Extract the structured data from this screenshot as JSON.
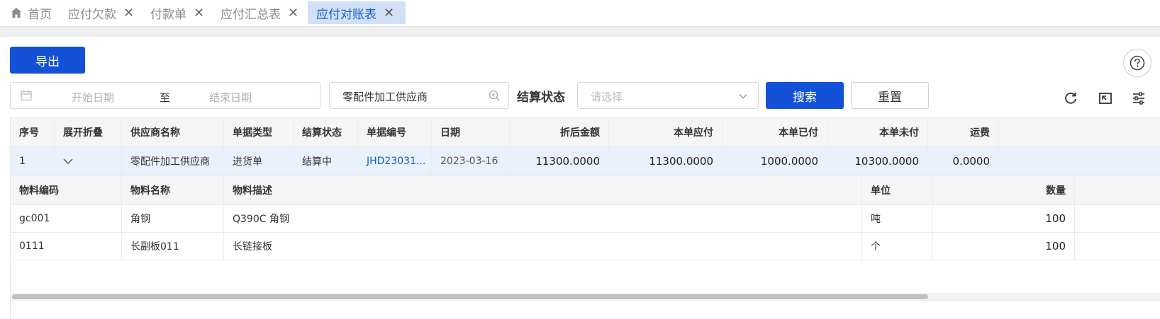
{
  "tabs": [
    {
      "label": "首页",
      "closable": false,
      "active": false
    },
    {
      "label": "应付欠款",
      "closable": true,
      "active": false
    },
    {
      "label": "付款单",
      "closable": true,
      "active": false
    },
    {
      "label": "应付汇总表",
      "closable": true,
      "active": false
    },
    {
      "label": "应付对账表",
      "closable": true,
      "active": true
    }
  ],
  "toolbar": {
    "export_label": "导出"
  },
  "filters": {
    "start_placeholder": "开始日期",
    "range_separator": "至",
    "end_placeholder": "结束日期",
    "supplier_value": "零配件加工供应商",
    "status_label": "结算状态",
    "status_placeholder": "请选择",
    "search_label": "搜索",
    "reset_label": "重置"
  },
  "table": {
    "columns": [
      "序号",
      "展开折叠",
      "供应商名称",
      "单据类型",
      "结算状态",
      "单据编号",
      "日期",
      "折后金额",
      "本单应付",
      "本单已付",
      "本单未付",
      "运费"
    ],
    "rows": [
      {
        "index": "1",
        "supplier": "零配件加工供应商",
        "doc_type": "进货单",
        "status": "结算中",
        "doc_no": "JHD23031...",
        "date": "2023-03-16",
        "discounted_amount": "11300.0000",
        "payable": "11300.0000",
        "paid": "1000.0000",
        "unpaid": "10300.0000",
        "freight": "0.0000"
      }
    ],
    "detail_columns": [
      "物料编码",
      "物料名称",
      "物料描述",
      "单位",
      "数量"
    ],
    "detail_rows": [
      {
        "code": "gc001",
        "name": "角钢",
        "desc": "Q390C 角钢",
        "unit": "吨",
        "qty": "100"
      },
      {
        "code": "0111",
        "name": "长副板011",
        "desc": "长链接板",
        "unit": "个",
        "qty": "100"
      }
    ]
  },
  "colors": {
    "primary": "#1351d6",
    "active_tab_bg": "#cfe0f7",
    "selected_row_bg": "#e9f1fd",
    "link": "#1a5bc9"
  },
  "icons": [
    "home-icon",
    "close-icon",
    "help-icon",
    "calendar-icon",
    "zoom-in-icon",
    "chevron-down-icon",
    "refresh-icon",
    "fullscreen-icon",
    "settings-icon"
  ]
}
